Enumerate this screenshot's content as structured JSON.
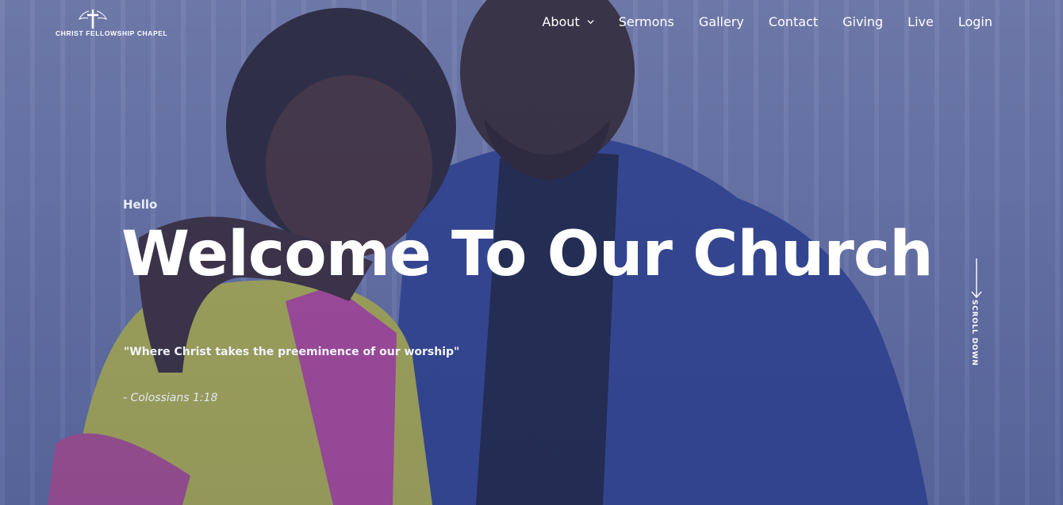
{
  "logo": {
    "text": "CHRIST FELLOWSHIP CHAPEL"
  },
  "nav": {
    "items": [
      "About",
      "Sermons",
      "Gallery",
      "Contact",
      "Giving",
      "Live",
      "Login"
    ]
  },
  "hero": {
    "eyebrow": "Hello",
    "headline": "Welcome To Our Church",
    "quote": "\"Where Christ takes the preeminence of our worship\"",
    "reference": "- Colossians 1:18",
    "scroll_label": "SCROLL DOWN"
  },
  "colors": {
    "overlay": "#3a4a96",
    "text": "#ffffff"
  },
  "icons": {
    "logo": "cross-wings-icon",
    "about_dropdown": "chevron-down-icon",
    "scroll": "arrow-down-icon"
  }
}
